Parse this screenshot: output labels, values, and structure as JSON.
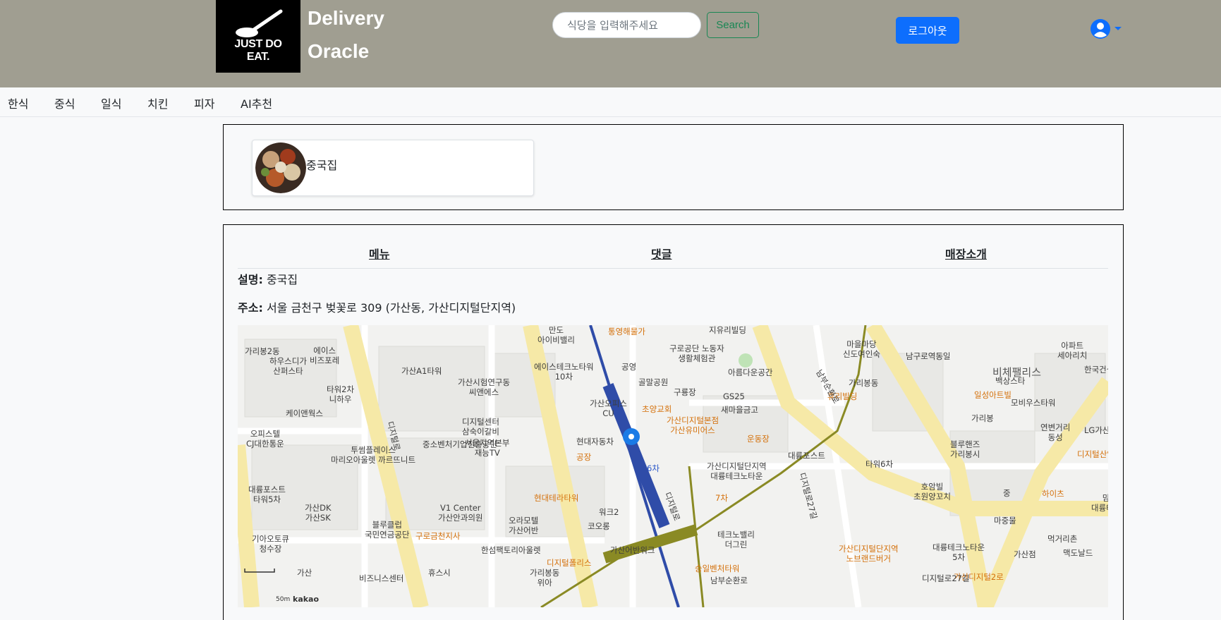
{
  "header": {
    "logo_text": "JUST DO EAT.",
    "brand_line1": "Delivery",
    "brand_line2": "Oracle",
    "search_placeholder": "식당을 입력해주세요",
    "search_button": "Search",
    "logout_button": "로그아웃"
  },
  "categories": [
    "한식",
    "중식",
    "일식",
    "치킨",
    "피자",
    "AI추천"
  ],
  "restaurant": {
    "name": "중국집"
  },
  "detail": {
    "tabs": [
      "메뉴",
      "댓글",
      "매장소개"
    ],
    "description_label": "설명:",
    "description_value": "중국집",
    "address_label": "주소:",
    "address_value": "서울 금천구 벚꽃로 309 (가산동, 가산디지털단지역)"
  },
  "map": {
    "scale_label": "50m",
    "provider": "kakao",
    "labels": [
      "만도",
      "아이비밸리",
      "통영해물가",
      "지유리빌딩",
      "에이스",
      "비즈포레",
      "하우스디가",
      "산퍼스타",
      "가산A1타워",
      "에이스테크노타워",
      "10차",
      "구로공단 노동자",
      "생활체험관",
      "공영",
      "가리봉2동",
      "마을마당",
      "신도여인숙",
      "남구로역동일",
      "아파트",
      "세아리치",
      "한국건설생활환경시험연구원",
      "가산시험연구동",
      "씨앤에스",
      "골말공원",
      "아름다운공간",
      "구룡장",
      "가리봉동",
      "비체팰리스",
      "백상스타",
      "타워2차",
      "니하우",
      "휴리빌딩",
      "GS25",
      "일성아트빌",
      "모비우스타워",
      "케이앤웍스",
      "가산오피스",
      "CU",
      "초양교회",
      "새마을금고",
      "가리봉",
      "연변거리",
      "동성",
      "LG가산",
      "디지털센터",
      "삼숙이갈비",
      "가산디지털본점",
      "가산유미어스",
      "오피스텔",
      "CJ대한통운",
      "중소벤처기업진흥공단",
      "서울지역본부",
      "재능TV",
      "현대자동차",
      "블루핸즈",
      "가리봉시",
      "디지털산업단지",
      "운동장",
      "투썸플레이스",
      "마리오아울렛 까르뜨니트",
      "공장",
      "대륭포스트",
      "타워6차",
      "가산디지털단지역",
      "대륭테크노타운",
      "6차",
      "대륭포스트",
      "타워5차",
      "호암빌",
      "초원양꼬치",
      "중",
      "하이츠",
      "맘스터치",
      "대륭테크노타운",
      "7차",
      "현대테라타워",
      "가산DK",
      "가산SK",
      "V1 Center",
      "가산안과의원",
      "오라모텔",
      "가산어반",
      "워크2",
      "마중물",
      "블루클럽",
      "국민연금공단",
      "구로금천지사",
      "코오롱",
      "테크노밸리",
      "더그린",
      "대륭테크노타운",
      "5차",
      "먹거리촌",
      "기아오토큐",
      "청수장",
      "한섬팩토리아울렛",
      "가산점",
      "맥도날드",
      "가산디지털단지역",
      "노브랜드버거",
      "디지털폴리스",
      "가산어반워크",
      "승일벤처타워",
      "가산",
      "비즈니스센터",
      "휴스시",
      "가리봉동",
      "위아",
      "가산디지털2로",
      "디지털로27길",
      "남부순환로",
      "디지털로"
    ]
  },
  "colors": {
    "header_bg": "#a09e91",
    "primary": "#0d6efd",
    "success": "#198754",
    "page_bg": "#f8f9fa"
  }
}
